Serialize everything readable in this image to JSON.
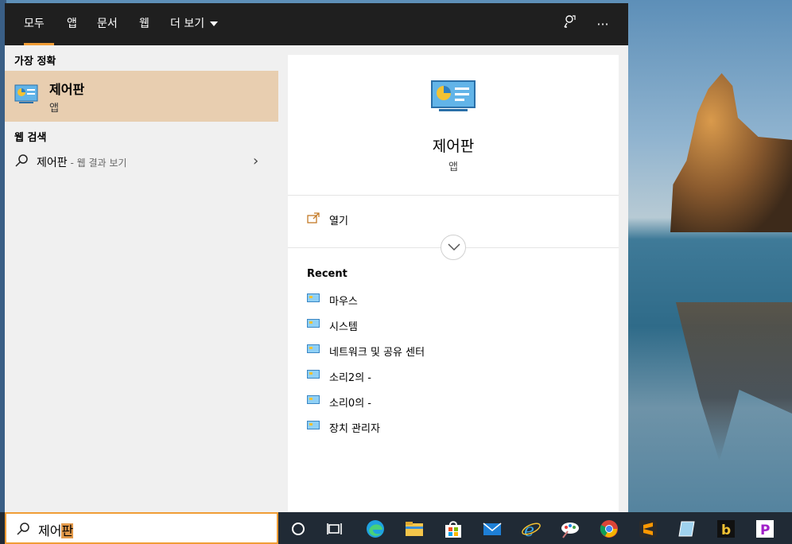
{
  "search_panel": {
    "tabs": [
      {
        "label": "모두",
        "active": true
      },
      {
        "label": "앱",
        "active": false
      },
      {
        "label": "문서",
        "active": false
      },
      {
        "label": "웹",
        "active": false
      },
      {
        "label": "더 보기",
        "active": false
      }
    ],
    "feedback_icon": "feedback-icon",
    "more_icon": "more-options-icon",
    "best_match": {
      "section_title": "가장 정확",
      "name": "제어판",
      "type": "앱",
      "icon": "control-panel-icon"
    },
    "web_search": {
      "section_title": "웹 검색",
      "query": "제어판",
      "suffix": " - 웹 결과 보기"
    }
  },
  "detail_card": {
    "title": "제어판",
    "subtitle": "앱",
    "open_label": "열기",
    "recent_title": "Recent",
    "recent_items": [
      "마우스",
      "시스템",
      "네트워크 및 공유 센터",
      "소리2의 -",
      "소리0의 -",
      "장치 관리자"
    ]
  },
  "taskbar": {
    "search_text_before": "제어",
    "search_text_highlight": "판",
    "icons": [
      "cortana-icon",
      "task-view-icon",
      "edge-icon",
      "file-explorer-icon",
      "store-icon",
      "mail-icon",
      "internet-explorer-icon",
      "paint-icon",
      "chrome-icon",
      "sublime-text-icon",
      "notes-icon",
      "app-b-icon",
      "app-p-icon"
    ]
  },
  "colors": {
    "accent": "#f09d36",
    "selected_bg": "#e8ceb0",
    "topbar_bg": "#1f1f1f",
    "taskbar_bg": "#202a35"
  }
}
